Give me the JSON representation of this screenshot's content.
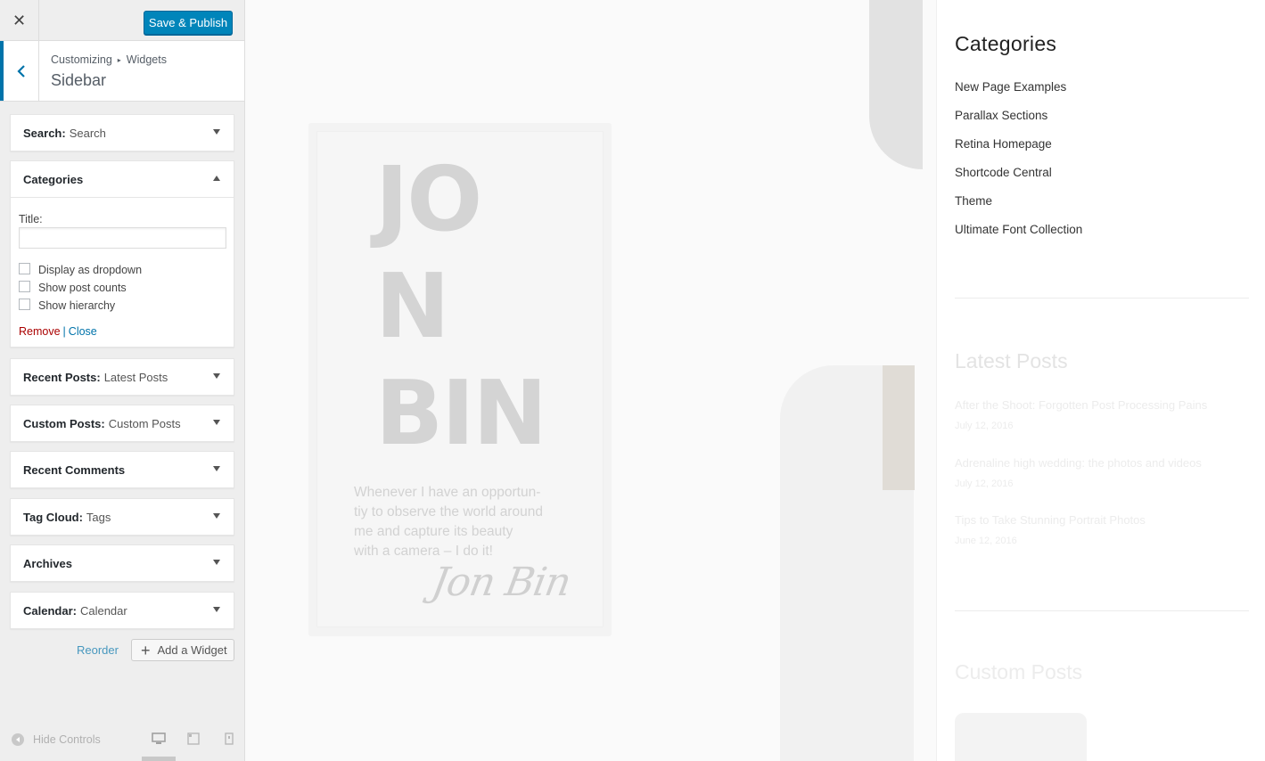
{
  "topbar": {
    "close_glyph": "✕",
    "publish_label": "Save & Publish"
  },
  "section": {
    "breadcrumb_root": "Customizing",
    "breadcrumb_sep": "▸",
    "breadcrumb_leaf": "Widgets",
    "title": "Sidebar"
  },
  "widgets": {
    "search": {
      "name": "Search:",
      "title": "Search"
    },
    "categories": {
      "name": "Categories",
      "title_label": "Title:",
      "title_value": "",
      "options": [
        "Display as dropdown",
        "Show post counts",
        "Show hierarchy"
      ],
      "remove_label": "Remove",
      "pipe": "|",
      "close_label": "Close"
    },
    "recent_posts": {
      "name": "Recent Posts:",
      "title": "Latest Posts"
    },
    "custom_posts": {
      "name": "Custom Posts:",
      "title": "Custom Posts"
    },
    "recent_comments": {
      "name": "Recent Comments"
    },
    "tag_cloud": {
      "name": "Tag Cloud:",
      "title": "Tags"
    },
    "archives": {
      "name": "Archives"
    },
    "calendar": {
      "name": "Calendar:",
      "title": "Calendar"
    }
  },
  "panel_actions": {
    "reorder_label": "Reorder",
    "add_widget_label": "Add a Widget",
    "plus": "+"
  },
  "footer": {
    "hide_controls_label": "Hide Controls"
  },
  "preview": {
    "hero": {
      "name_line1": "JO",
      "name_line2": "N",
      "name_line3": "BIN",
      "quote_lines": [
        "Whenever I have an opportun-",
        "tiy to observe the world around",
        "me and capture its beauty",
        "with a camera – I do it!"
      ],
      "signature": "Jon Bin"
    },
    "categories_title": "Categories",
    "categories": [
      "New Page Examples",
      "Parallax Sections",
      "Retina Homepage",
      "Shortcode Central",
      "Theme",
      "Ultimate Font Collection"
    ],
    "latest_posts_title": "Latest Posts",
    "latest_posts": [
      {
        "title": "After the Shoot: Forgotten Post Processing Pains",
        "date": "July 12, 2016"
      },
      {
        "title": "Adrenaline high wedding: the photos and videos",
        "date": "July 12, 2016"
      },
      {
        "title": "Tips to Take Stunning Portrait Photos",
        "date": "June 12, 2016"
      }
    ],
    "custom_posts_title": "Custom Posts"
  },
  "colors": {
    "accent": "#0085ba",
    "link": "#0073aa",
    "remove": "#aa0000"
  }
}
